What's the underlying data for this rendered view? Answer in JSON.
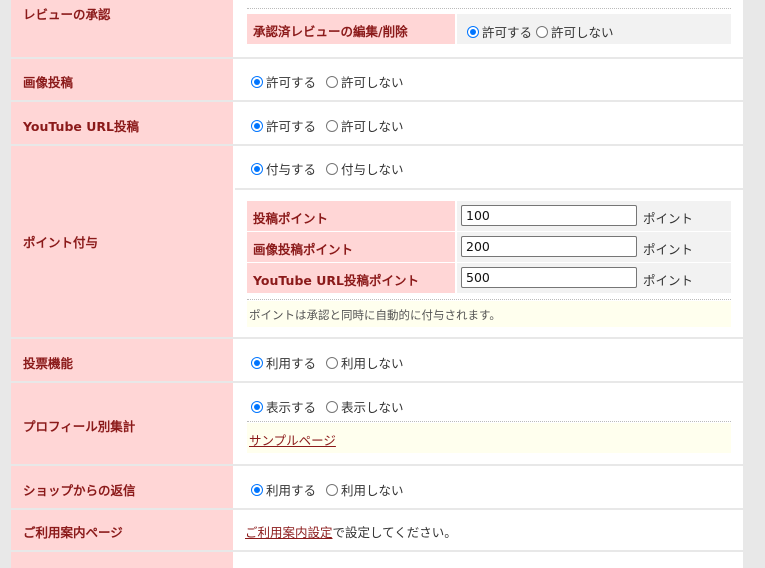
{
  "review_approval": {
    "label": "レビューの承認",
    "sub_label": "承認済レビューの編集/削除",
    "options": [
      "許可する",
      "許可しない"
    ],
    "selected": 0
  },
  "image_post": {
    "label": "画像投稿",
    "options": [
      "許可する",
      "許可しない"
    ],
    "selected": 0
  },
  "youtube_post": {
    "label": "YouTube URL投稿",
    "options": [
      "許可する",
      "許可しない"
    ],
    "selected": 0
  },
  "points": {
    "label": "ポイント付与",
    "options": [
      "付与する",
      "付与しない"
    ],
    "selected": 0,
    "rows": [
      {
        "label": "投稿ポイント",
        "value": "100",
        "unit": "ポイント"
      },
      {
        "label": "画像投稿ポイント",
        "value": "200",
        "unit": "ポイント"
      },
      {
        "label": "YouTube URL投稿ポイント",
        "value": "500",
        "unit": "ポイント"
      }
    ],
    "note": "ポイントは承認と同時に自動的に付与されます。"
  },
  "voting": {
    "label": "投票機能",
    "options": [
      "利用する",
      "利用しない"
    ],
    "selected": 0
  },
  "profile_stats": {
    "label": "プロフィール別集計",
    "options": [
      "表示する",
      "表示しない"
    ],
    "selected": 0,
    "sample_link": "サンプルページ"
  },
  "shop_reply": {
    "label": "ショップからの返信",
    "options": [
      "利用する",
      "利用しない"
    ],
    "selected": 0
  },
  "guide_page": {
    "label": "ご利用案内ページ",
    "link_text": "ご利用案内設定",
    "suffix": "で設定してください。"
  }
}
